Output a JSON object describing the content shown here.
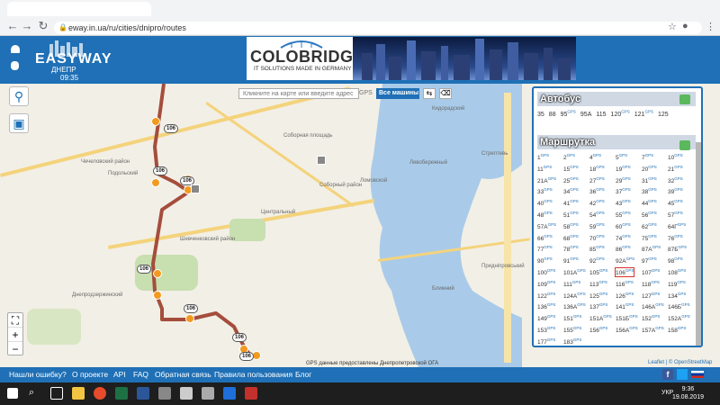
{
  "browser": {
    "url": "eway.in.ua/ru/cities/dnipro/routes"
  },
  "header": {
    "logo": "EASYWAY",
    "city": "ДНЕПР",
    "time": "09:35"
  },
  "banner": {
    "title": "COLOBRIDGE",
    "subtitle": "IT SOLUTIONS MADE IN GERMANY"
  },
  "search": {
    "placeholder": "Кликните на карте или введите адрес",
    "gps": "GPS",
    "all_cars": "Все машины"
  },
  "map": {
    "copyright": "GPS данные предоставлены Днепропетровской ОГА",
    "osm": "© OpenStreetMap",
    "leaflet": "Leaflet",
    "poi": [
      "Чечеловский район",
      "Подольский",
      "Шевченковский район",
      "Центральный",
      "Соборный район",
      "Ломовской",
      "Соборная площадь",
      "Днепродзержинский",
      "Кидорадский",
      "Левобережный",
      "Стрептевь",
      "Придніпровський",
      "Ближний"
    ],
    "routes": [
      "106",
      "106",
      "106",
      "106",
      "106",
      "106",
      "106"
    ]
  },
  "panel": {
    "bus_title": "Автобус",
    "bus_routes": [
      "35",
      "88",
      "95",
      "95А",
      "115",
      "120",
      "121",
      "125"
    ],
    "bus_gps": [
      "",
      "",
      "GPS",
      "",
      "",
      "GPS",
      "GPS",
      ""
    ],
    "marsh_title": "Маршрутка",
    "marsh_rows": [
      [
        "1",
        "2",
        "4",
        "5",
        "7",
        "10"
      ],
      [
        "11",
        "15",
        "18",
        "19",
        "20",
        "21"
      ],
      [
        "21А",
        "25",
        "27",
        "29",
        "31",
        "32"
      ],
      [
        "33",
        "34",
        "36",
        "37",
        "38",
        "39"
      ],
      [
        "40",
        "41",
        "42",
        "43",
        "44",
        "45"
      ],
      [
        "48",
        "51",
        "54",
        "55",
        "56",
        "57"
      ],
      [
        "57А",
        "58",
        "59",
        "60",
        "62",
        "64Г"
      ],
      [
        "66",
        "68",
        "70",
        "74",
        "75",
        "76"
      ],
      [
        "77",
        "78",
        "85",
        "86",
        "87А",
        "87Б"
      ],
      [
        "90",
        "91",
        "92",
        "92А",
        "97",
        "98"
      ],
      [
        "100",
        "101А",
        "105",
        "106",
        "107",
        "108"
      ],
      [
        "109",
        "111",
        "113",
        "116",
        "118",
        "119"
      ],
      [
        "122",
        "124А",
        "125",
        "126",
        "127",
        "134"
      ],
      [
        "136",
        "136А",
        "137",
        "141",
        "146А",
        "146Б"
      ],
      [
        "149",
        "151",
        "151А",
        "151Б",
        "152",
        "152А"
      ],
      [
        "153",
        "155",
        "156",
        "156А",
        "157А",
        "158"
      ],
      [
        "177",
        "183"
      ]
    ],
    "selected": "106"
  },
  "footer": {
    "links": [
      "Нашли ошибку?",
      "О проекте",
      "API",
      "FAQ",
      "Обратная связь",
      "Правила пользования",
      "Блог"
    ]
  },
  "taskbar": {
    "time": "9:36",
    "date": "19.08.2019",
    "lang": "УКР"
  }
}
